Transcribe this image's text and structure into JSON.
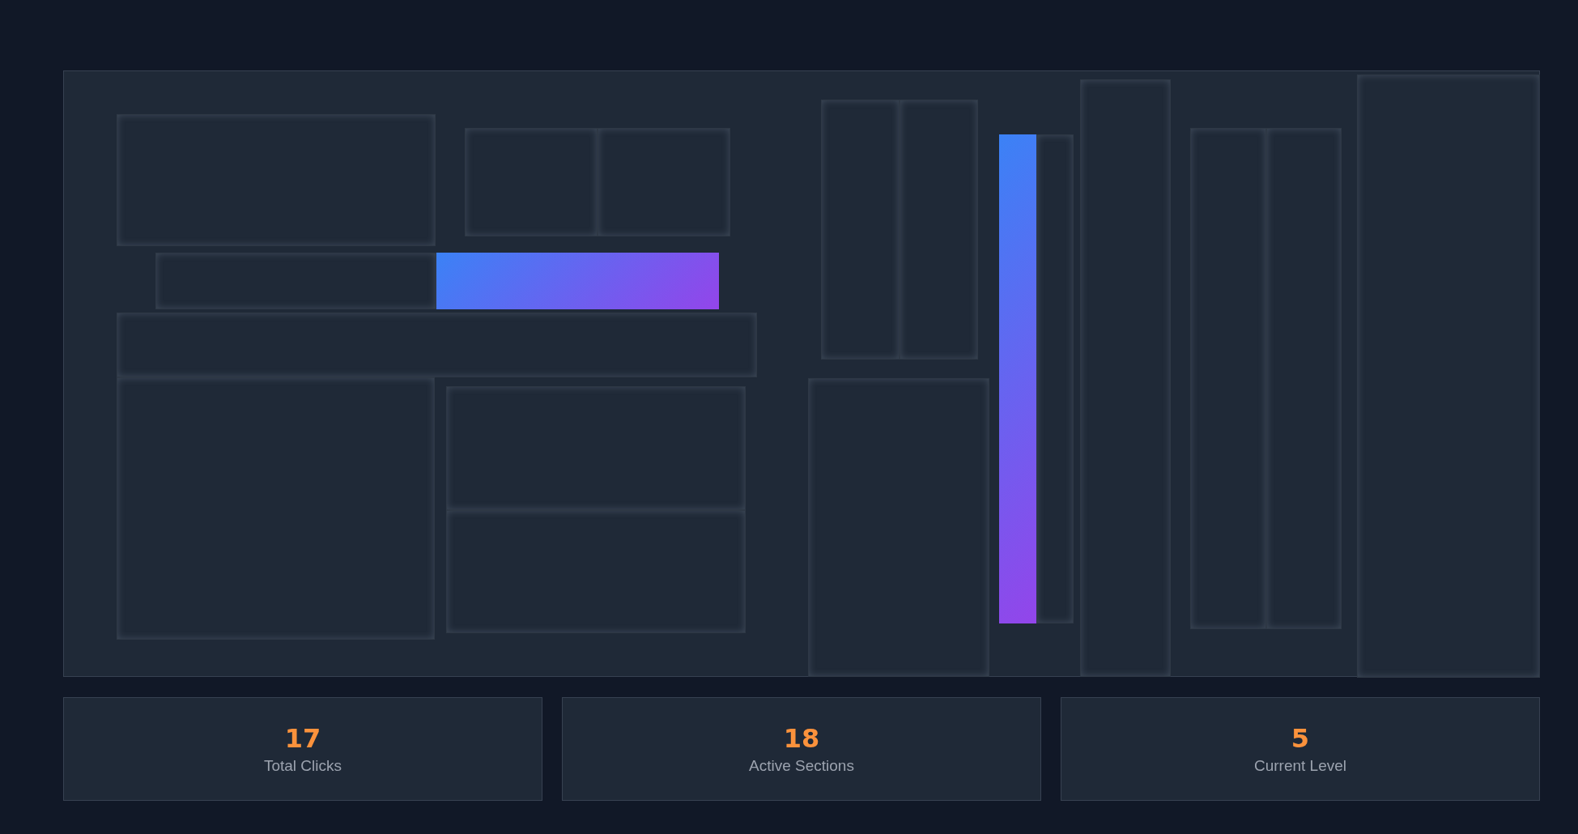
{
  "sections": [
    {
      "active": false
    },
    {
      "active": false
    },
    {
      "active": false
    },
    {
      "active": false
    },
    {
      "active": true
    },
    {
      "active": false
    },
    {
      "active": false
    },
    {
      "active": false
    },
    {
      "active": false
    },
    {
      "active": false
    },
    {
      "active": false
    },
    {
      "active": false
    },
    {
      "active": true
    },
    {
      "active": false
    },
    {
      "active": false
    },
    {
      "active": false
    },
    {
      "active": false
    },
    {
      "active": false
    }
  ],
  "stats": [
    {
      "value": "17",
      "label": "Total Clicks"
    },
    {
      "value": "18",
      "label": "Active Sections"
    },
    {
      "value": "5",
      "label": "Current Level"
    }
  ]
}
